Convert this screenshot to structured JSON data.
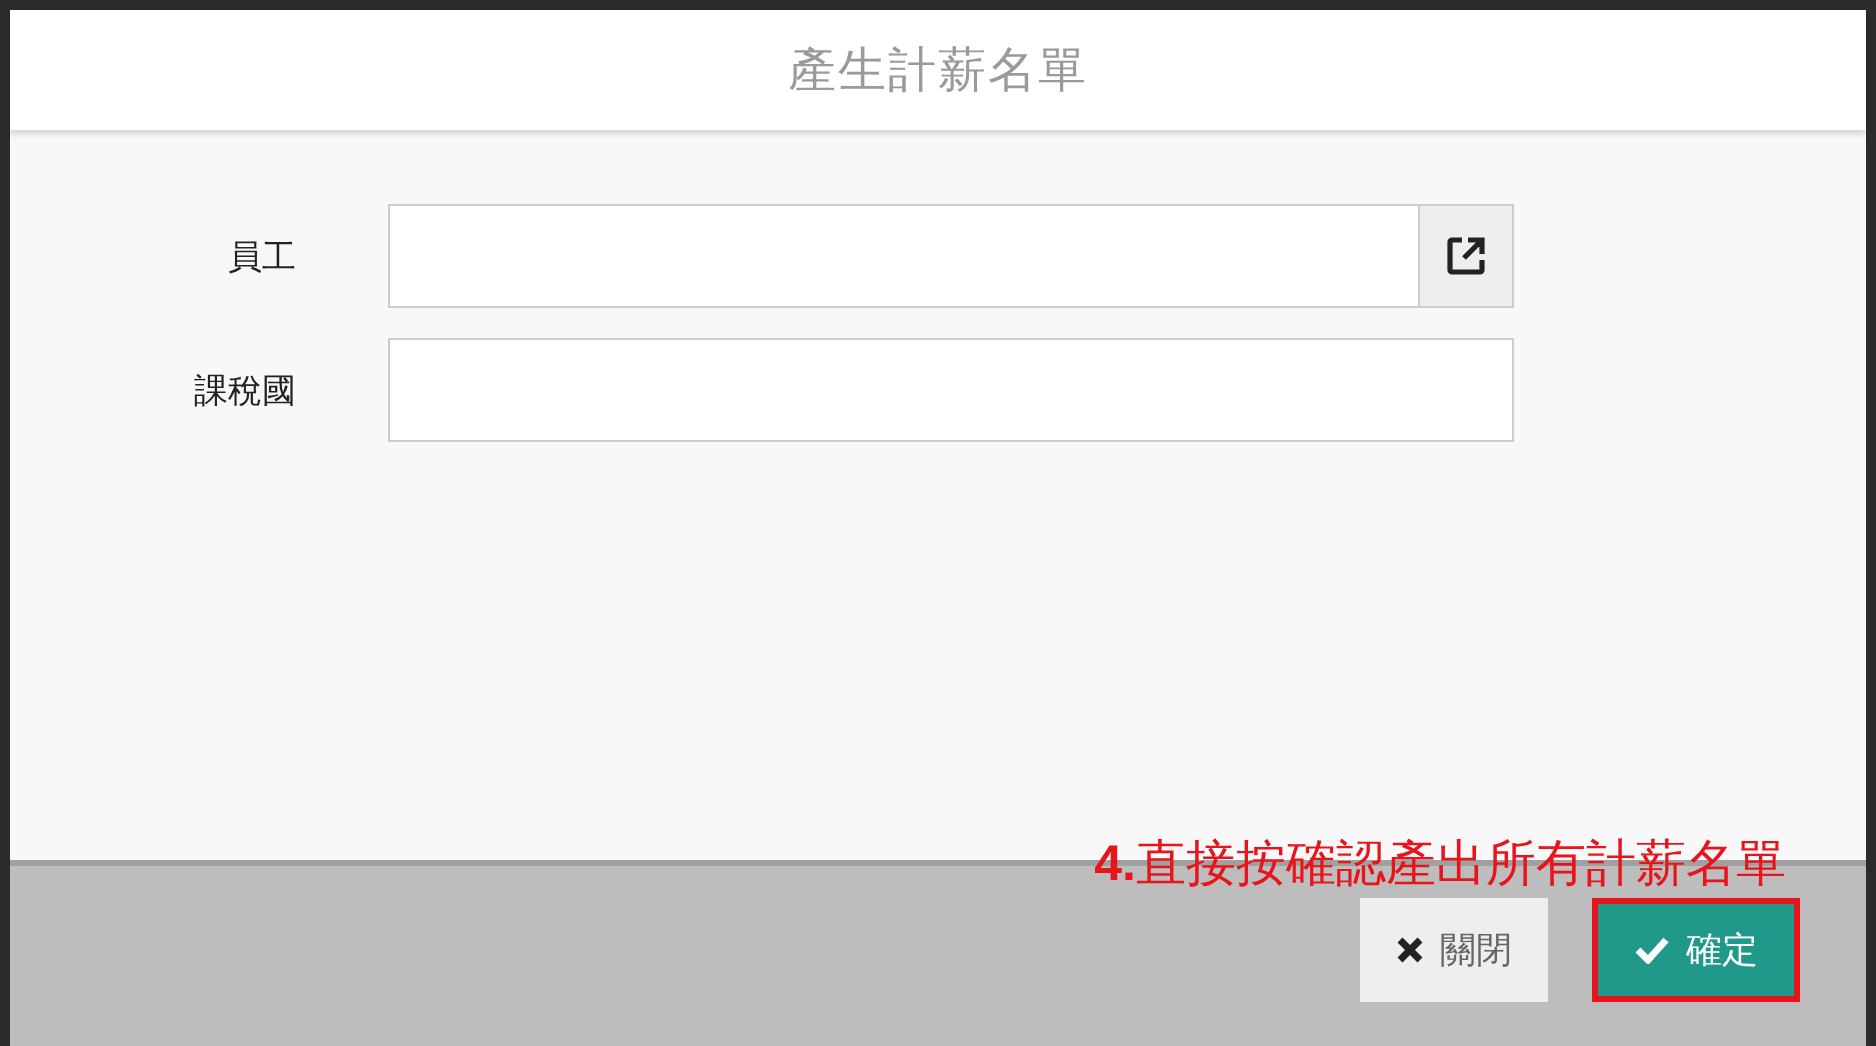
{
  "dialog": {
    "title": "產生計薪名單"
  },
  "fields": [
    {
      "label": "員工",
      "kind": "lookup"
    },
    {
      "label": "課稅國",
      "kind": "text"
    }
  ],
  "annotation": "**4.**直接按確認產出所有計薪名單",
  "buttons": [
    {
      "label": "關閉",
      "kind": "close",
      "highlighted": false
    },
    {
      "label": "確定",
      "kind": "confirm",
      "highlighted": true
    }
  ]
}
